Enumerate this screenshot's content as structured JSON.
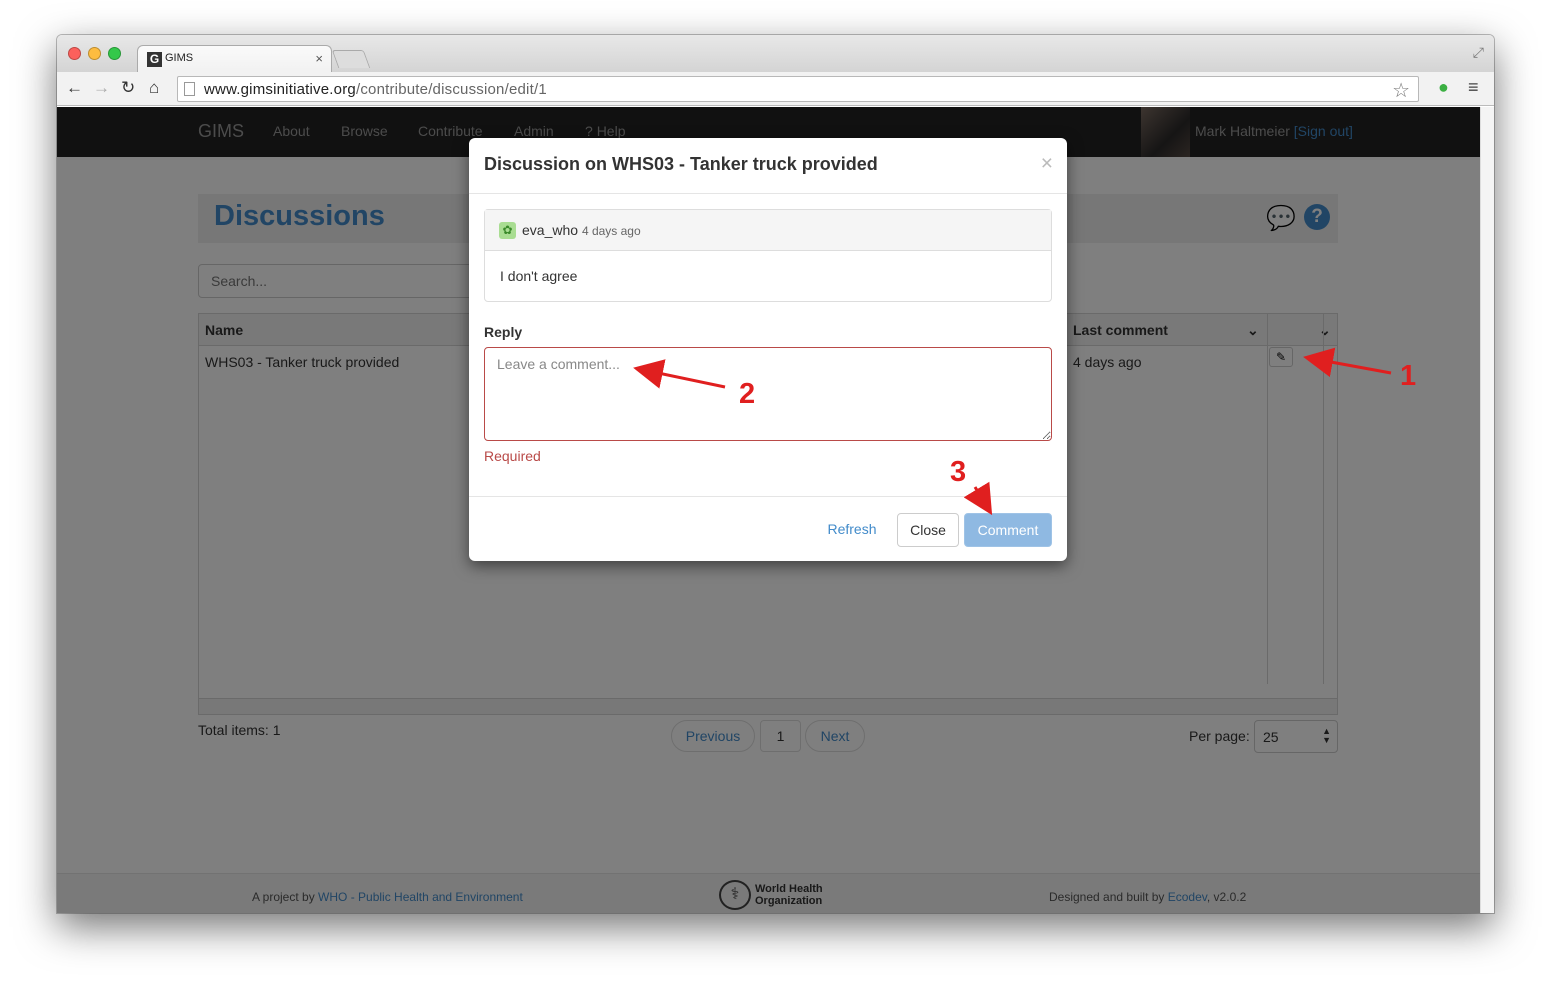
{
  "browser": {
    "tab_title": "GIMS",
    "tab_favicon": "G",
    "tab_close": "×",
    "url_domain": "www.gimsinitiative.org",
    "url_path": "/contribute/discussion/edit/1"
  },
  "navbar": {
    "brand": "GIMS",
    "items": [
      "About",
      "Browse",
      "Contribute",
      "Admin",
      "Help"
    ],
    "user_name": "Mark Haltmeier",
    "sign_out": "[Sign out]"
  },
  "page": {
    "title": "Discussions",
    "search_placeholder": "Search...",
    "columns": {
      "name": "Name",
      "last_comment": "Last comment"
    },
    "rows": [
      {
        "name": "WHS03 - Tanker truck provided",
        "last_comment": "4 days ago"
      }
    ],
    "total": "Total items: 1",
    "pagination": {
      "previous": "Previous",
      "current": "1",
      "next": "Next"
    },
    "per_page_label": "Per page:",
    "per_page_value": "25"
  },
  "footer": {
    "project_prefix": "A project by ",
    "project_link": "WHO - Public Health and Environment",
    "who_logo_text_1": "World Health",
    "who_logo_text_2": "Organization",
    "built_prefix": "Designed and built by ",
    "built_link": "Ecodev",
    "version": ", v2.0.2"
  },
  "modal": {
    "title": "Discussion on WHS03 - Tanker truck provided",
    "close": "×",
    "comment_user": "eva_who",
    "comment_time": "4 days ago",
    "comment_body": "I don't agree",
    "reply_label": "Reply",
    "reply_placeholder": "Leave a comment...",
    "validation": "Required",
    "buttons": {
      "refresh": "Refresh",
      "close": "Close",
      "comment": "Comment"
    }
  },
  "annotations": [
    "1",
    "2",
    "3"
  ],
  "colors": {
    "annotation": "#e01f1f",
    "link": "#428bca",
    "error": "#b94a48",
    "navbar": "#222222"
  }
}
